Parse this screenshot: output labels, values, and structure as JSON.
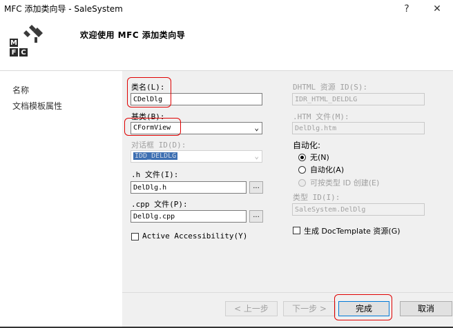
{
  "window": {
    "title": "MFC 添加类向导 - SaleSystem",
    "help": "?",
    "close": "✕"
  },
  "header": {
    "logo_mark": "MFC",
    "welcome": "欢迎使用 MFC 添加类向导"
  },
  "sidebar": {
    "items": [
      {
        "label": "名称"
      },
      {
        "label": "文档模板属性"
      }
    ]
  },
  "left": {
    "class_name_label": "类名(L):",
    "class_name_value": "CDelDlg",
    "base_class_label": "基类(B):",
    "base_class_value": "CFormView",
    "dialog_id_label": "对话框 ID(D):",
    "dialog_id_value": "IDD_DELDLG",
    "h_file_label": ".h 文件(I):",
    "h_file_value": "DelDlg.h",
    "cpp_file_label": ".cpp 文件(P):",
    "cpp_file_value": "DelDlg.cpp",
    "browse_label": "...",
    "accessibility_label": "Active Accessibility(Y)"
  },
  "right": {
    "dhtml_label": "DHTML 资源 ID(S):",
    "dhtml_value": "IDR_HTML_DELDLG",
    "htm_label": ".HTM 文件(M):",
    "htm_value": "DelDlg.htm",
    "automation_label": "自动化:",
    "radio_none": "无(N)",
    "radio_auto": "自动化(A)",
    "radio_typeid": "可按类型 ID 创建(E)",
    "type_id_label": "类型 ID(I):",
    "type_id_value": "SaleSystem.DelDlg",
    "doctemplate_label": "生成 DocTemplate 资源(G)"
  },
  "footer": {
    "prev": "< 上一步",
    "next": "下一步 >",
    "finish": "完成",
    "cancel": "取消"
  },
  "colors": {
    "panel_bg": "#f0f0f0",
    "highlight_red": "#e00000",
    "selection_blue": "#3d6fb2",
    "focus_blue": "#0078d7"
  }
}
